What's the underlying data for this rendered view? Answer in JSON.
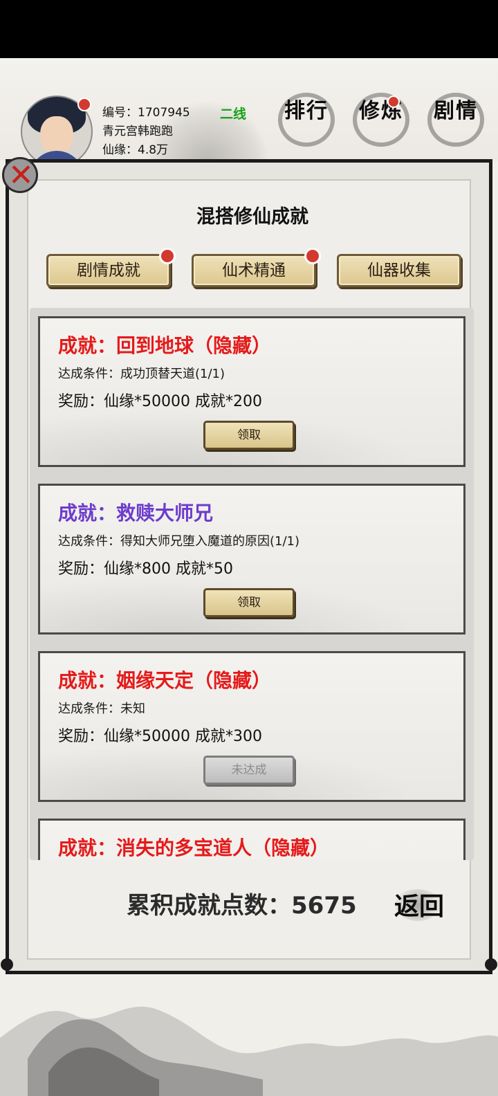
{
  "player": {
    "id_line": "编号：1707945",
    "name": "青元宫韩跑跑",
    "xianyuan": "仙缘：4.8万",
    "server_line": "二线"
  },
  "top_nav": [
    {
      "label": "排行",
      "has_dot": false
    },
    {
      "label": "修炼",
      "has_dot": true
    },
    {
      "label": "剧情",
      "has_dot": false
    }
  ],
  "panel": {
    "title": "混搭修仙成就",
    "tabs": [
      {
        "label": "剧情成就",
        "has_dot": true
      },
      {
        "label": "仙术精通",
        "has_dot": true
      },
      {
        "label": "仙器收集",
        "has_dot": false
      }
    ],
    "achievements": [
      {
        "title": "成就：回到地球（隐藏）",
        "condition": "达成条件：成功顶替天道(1/1)",
        "reward": "奖励：仙缘*50000 成就*200",
        "button": "领取",
        "title_color": "red",
        "enabled": true
      },
      {
        "title": "成就：救赎大师兄",
        "condition": "达成条件：得知大师兄堕入魔道的原因(1/1)",
        "reward": "奖励：仙缘*800 成就*50",
        "button": "领取",
        "title_color": "purple",
        "enabled": true
      },
      {
        "title": "成就：姻缘天定（隐藏）",
        "condition": "达成条件：未知",
        "reward": "奖励：仙缘*50000 成就*300",
        "button": "未达成",
        "title_color": "red",
        "enabled": false
      },
      {
        "title": "成就：消失的多宝道人（隐藏）",
        "title_color": "red"
      }
    ],
    "total_label": "累积成就点数：5675",
    "back_label": "返回"
  },
  "colors": {
    "red": "#e51a1a",
    "purple": "#6d3ccc",
    "server_green": "#18a31a",
    "dot_red": "#d23a2e"
  }
}
